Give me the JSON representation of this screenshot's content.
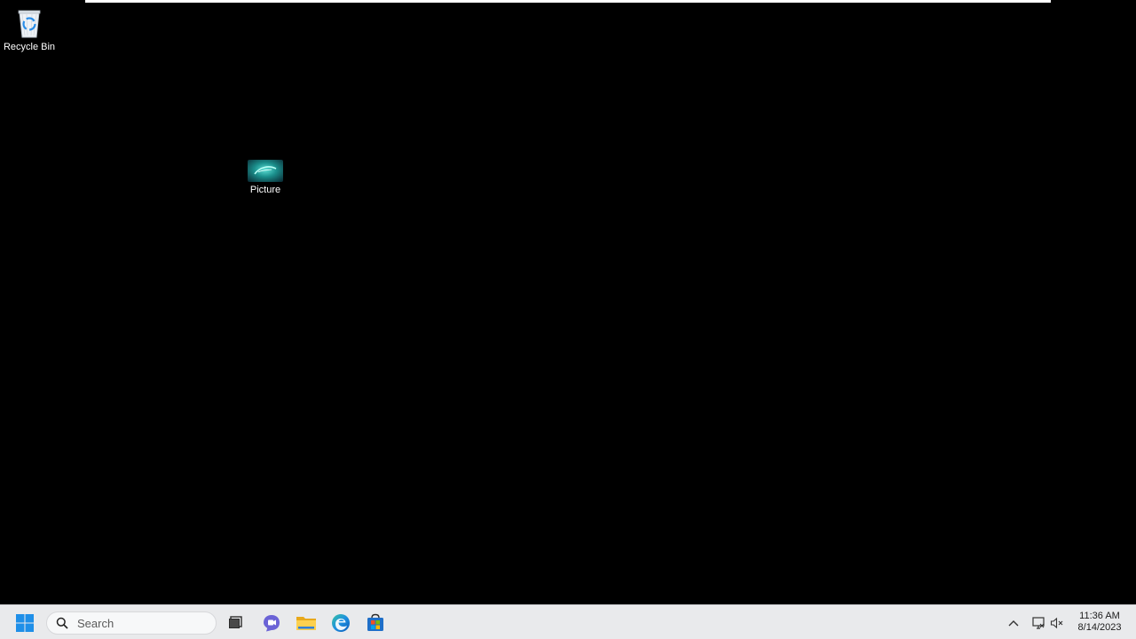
{
  "desktop": {
    "icons": [
      {
        "label": "Recycle Bin",
        "icon": "recycle-bin-icon"
      },
      {
        "label": "Picture",
        "icon": "picture-thumbnail-icon"
      }
    ]
  },
  "taskbar": {
    "start_icon": "windows-start-icon",
    "search": {
      "placeholder": "Search",
      "icon": "search-icon"
    },
    "pinned": [
      {
        "name": "task-view",
        "icon": "task-view-icon"
      },
      {
        "name": "chat",
        "icon": "teams-chat-icon"
      },
      {
        "name": "file-explorer",
        "icon": "folder-icon"
      },
      {
        "name": "edge",
        "icon": "edge-browser-icon"
      },
      {
        "name": "store",
        "icon": "store-icon"
      }
    ],
    "tray": {
      "chevron_icon": "chevron-up-icon",
      "network_icon": "network-icon",
      "volume_icon": "volume-muted-icon",
      "time": "11:36 AM",
      "date": "8/14/2023"
    }
  },
  "colors": {
    "desktop_bg": "#000000",
    "taskbar_bg": "#e9eaec",
    "accent": "#0078d4"
  }
}
